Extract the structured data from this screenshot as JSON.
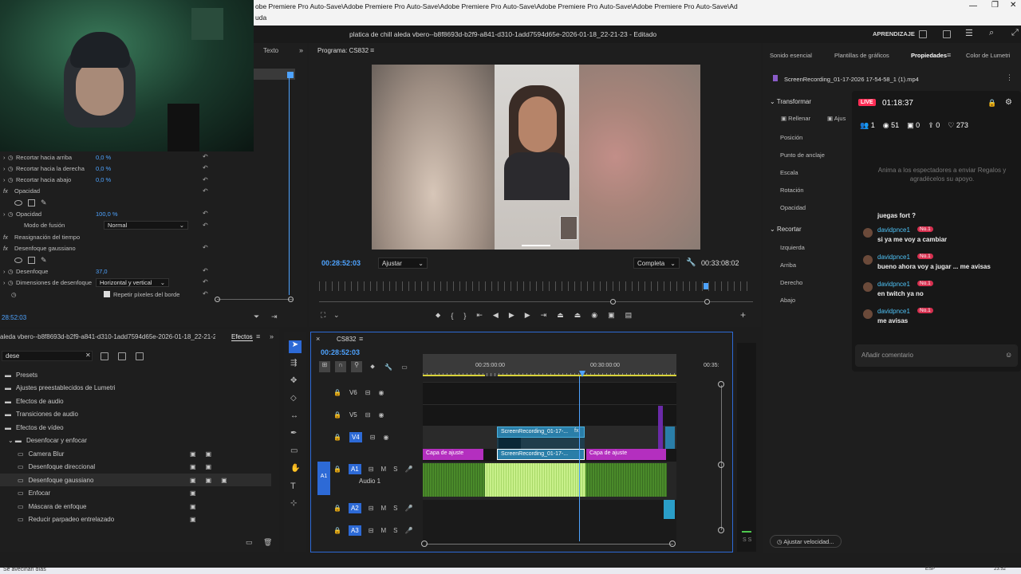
{
  "window": {
    "path_title": "obe Premiere Pro Auto-Save\\Adobe Premiere Pro Auto-Save\\Adobe Premiere Pro Auto-Save\\Adobe Premiere Pro Auto-Save\\Adobe Premiere Pro Auto-Save\\Ad",
    "path_title_2": "uda",
    "project_title": "platica de chill aleda vbero--b8f8693d-b2f9-a841-d310-1add7594d65e-2026-01-18_22-21-23 - Editado",
    "learn_label": "APRENDIZAJE"
  },
  "left_panel": {
    "tab_texto": "Texto",
    "props": [
      {
        "label": "Recortar hacia arriba",
        "value": "0,0 %"
      },
      {
        "label": "Recortar hacia la derecha",
        "value": "0,0 %"
      },
      {
        "label": "Recortar hacia abajo",
        "value": "0,0 %"
      }
    ],
    "opacity_section": "Opacidad",
    "opacity_label": "Opacidad",
    "opacity_value": "100,0 %",
    "blend_label": "Modo de fusión",
    "blend_value": "Normal",
    "time_remap": "Reasignación del tiempo",
    "gauss_section": "Desenfoque gaussiano",
    "blur_label": "Desenfoque",
    "blur_value": "37,0",
    "blur_dim_label": "Dimensiones de desenfoque",
    "blur_dim_value": "Horizontal y vertical",
    "repeat_edges": "Repetir píxeles del borde",
    "timecode": "28:52:03"
  },
  "effects_panel": {
    "sequence_tab": "aleda vbero--b8f8693d-b2f9-a841-d310-1add7594d65e-2026-01-18_22-21-23",
    "effects_tab": "Efectos",
    "search_value": "dese",
    "items": [
      {
        "label": "Presets",
        "type": "folder"
      },
      {
        "label": "Ajustes preestablecidos de Lumetri",
        "type": "folder"
      },
      {
        "label": "Efectos de audio",
        "type": "folder"
      },
      {
        "label": "Transiciones de audio",
        "type": "folder"
      },
      {
        "label": "Efectos de vídeo",
        "type": "folder"
      },
      {
        "label": "Desenfocar y enfocar",
        "type": "folder-open"
      },
      {
        "label": "Camera Blur",
        "type": "effect"
      },
      {
        "label": "Desenfoque direccional",
        "type": "effect"
      },
      {
        "label": "Desenfoque gaussiano",
        "type": "effect-selected"
      },
      {
        "label": "Enfocar",
        "type": "effect"
      },
      {
        "label": "Máscara de enfoque",
        "type": "effect"
      },
      {
        "label": "Reducir parpadeo entrelazado",
        "type": "effect"
      }
    ]
  },
  "program_monitor": {
    "tab": "Programa: CS832",
    "timecode": "00:28:52:03",
    "fit_value": "Ajustar",
    "quality_value": "Completa",
    "duration": "00:33:08:02"
  },
  "timeline": {
    "tab": "CS832",
    "timecode": "00:28:52:03",
    "ruler": [
      "00:25:00:00",
      "00:30:00:00",
      "00:35:"
    ],
    "tracks": [
      {
        "name": "V6",
        "label": ""
      },
      {
        "name": "V5",
        "label": ""
      },
      {
        "name": "V4",
        "label": ""
      },
      {
        "name": "A1",
        "label": "Audio 1"
      },
      {
        "name": "A2",
        "label": ""
      },
      {
        "name": "A3",
        "label": ""
      }
    ],
    "clips": {
      "screen1": "ScreenRecording_01-17-...",
      "screen2": "ScreenRecording_01-17-...",
      "capa1": "Capa de ajuste",
      "capa2": "Capa de ajuste",
      "fx": "fx"
    },
    "meter_db": "S S"
  },
  "right_panel": {
    "tabs": [
      "Sonido esencial",
      "Plantillas de gráficos",
      "Propiedades",
      "Color de Lumetri"
    ],
    "active_tab": "Propiedades",
    "file": "ScreenRecording_01-17-2026 17-54-58_1 (1).mp4",
    "transform_section": "Transformar",
    "fill_label": "Rellenar",
    "adjust_label": "Ajus",
    "props": [
      "Posición",
      "Punto de anclaje",
      "Escala",
      "Rotación",
      "Opacidad"
    ],
    "crop_section": "Recortar",
    "crop_props": [
      "Izquierda",
      "Arriba",
      "Derecho",
      "Abajo"
    ],
    "speed_button": "Ajustar velocidad..."
  },
  "chat_overlay": {
    "live_badge": "LIVE",
    "live_time": "01:18:37",
    "stats": [
      "1",
      "51",
      "0",
      "0",
      "273"
    ],
    "hint": "Anima a los espectadores a enviar Regalos y agradécelos su apoyo.",
    "messages": [
      {
        "user": "",
        "badge": "",
        "text": "juegas fort ?"
      },
      {
        "user": "davidpnce1",
        "badge": "No.1",
        "text": "si ya me voy a cambiar"
      },
      {
        "user": "davidpnce1",
        "badge": "No.1",
        "text": "bueno ahora voy a jugar ... me avisas"
      },
      {
        "user": "davidpnce1",
        "badge": "No.1",
        "text": "en twitch ya no"
      },
      {
        "user": "davidpnce1",
        "badge": "No.1",
        "text": "me avisas"
      }
    ],
    "comment_placeholder": "Añadir comentario"
  },
  "taskbar": {
    "left_text": "Se avecinan días",
    "time": "23:52",
    "lang": "ESP"
  },
  "colors": {
    "accent_blue": "#2d8ceb",
    "video_clip": "#2a7ea8",
    "adjust_clip": "#b42fbf",
    "audio_clip": "#4a8a2a",
    "playhead": "#4ea3ff",
    "live_red": "#ff2d55"
  }
}
